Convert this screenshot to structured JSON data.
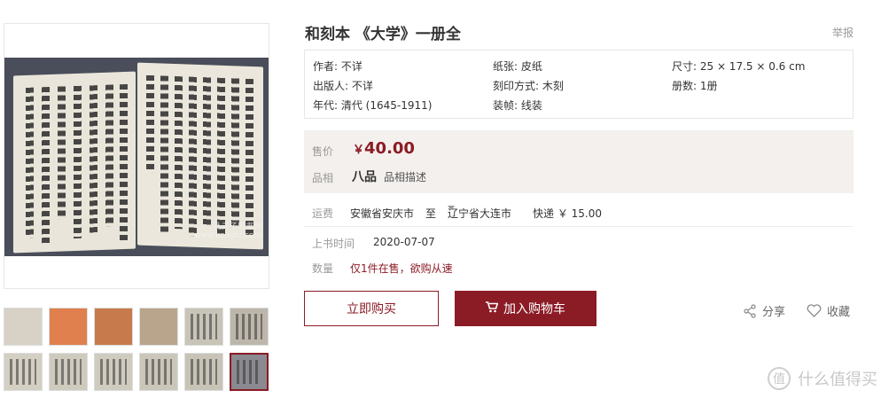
{
  "product": {
    "title": "和刻本 《大学》一册全",
    "report_label": "举报"
  },
  "gallery": {
    "watermark_line1": "孔夫子旧书网",
    "watermark_line2": "www.kongfz.com",
    "thumbs": [
      {
        "color": "#d8d2c6",
        "lines": false
      },
      {
        "color": "#e0804e",
        "lines": false
      },
      {
        "color": "#c77a4c",
        "lines": false
      },
      {
        "color": "#b9a58c",
        "lines": false
      },
      {
        "color": "#c9c4b8",
        "lines": true
      },
      {
        "color": "#bdb7ab",
        "lines": true
      },
      {
        "color": "#d4cfc3",
        "lines": true
      },
      {
        "color": "#cfcabe",
        "lines": true
      },
      {
        "color": "#d0cbbf",
        "lines": true
      },
      {
        "color": "#cbc6ba",
        "lines": true
      },
      {
        "color": "#c8c3b7",
        "lines": true
      },
      {
        "color": "#8a8a90",
        "lines": true,
        "active": true
      }
    ]
  },
  "attributes": {
    "author": "作者: 不详",
    "publisher": "出版人: 不详",
    "era": "年代: 清代 (1645-1911)",
    "paper": "纸张: 皮纸",
    "print_method": "刻印方式: 木刻",
    "binding": "装帧: 线装",
    "size": "尺寸: 25 × 17.5 × 0.6 cm",
    "volumes": "册数: 1册"
  },
  "pricing": {
    "price_label": "售价",
    "currency": "￥",
    "price": "40.00",
    "condition_label": "品相",
    "condition": "八品",
    "condition_desc": "品相描述"
  },
  "shipping": {
    "label": "运费",
    "from": "安徽省安庆市",
    "to_word": "至",
    "to": "辽宁省大连市",
    "method": "快递 ￥ 15.00"
  },
  "listing": {
    "date_label": "上书时间",
    "date": "2020-07-07",
    "qty_label": "数量",
    "qty_text": "仅1件在售，欲购从速"
  },
  "actions": {
    "buy_now": "立即购买",
    "add_cart": "加入购物车",
    "share": "分享",
    "favorite": "收藏"
  },
  "brand": {
    "badge": "值",
    "name": "什么值得买"
  },
  "colors": {
    "accent": "#8b1b25",
    "price_bg": "#f3f0ed"
  }
}
